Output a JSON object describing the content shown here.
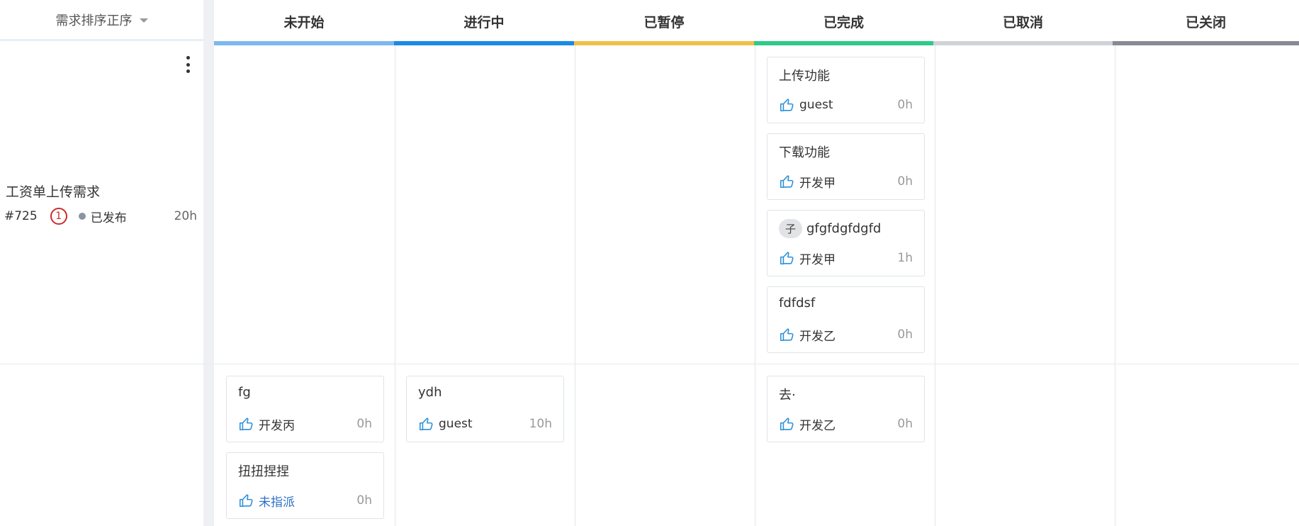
{
  "sort_label": "需求排序正序",
  "columns": [
    {
      "label": "未开始",
      "color": "#7db8ee"
    },
    {
      "label": "进行中",
      "color": "#1b8ae6"
    },
    {
      "label": "已暂停",
      "color": "#f0c04c"
    },
    {
      "label": "已完成",
      "color": "#2ecb88"
    },
    {
      "label": "已取消",
      "color": "#cfd3d8"
    },
    {
      "label": "已关闭",
      "color": "#888b94"
    }
  ],
  "story": {
    "title": "工资单上传需求",
    "id": "#725",
    "priority": "1",
    "status": "已发布",
    "hours": "20h"
  },
  "cards": {
    "upload": {
      "title": "上传功能",
      "assignee": "guest",
      "hours": "0h"
    },
    "download": {
      "title": "下载功能",
      "assignee": "开发甲",
      "hours": "0h"
    },
    "child": {
      "badge": "子",
      "title": "gfgfdgfdgfd",
      "assignee": "开发甲",
      "hours": "1h"
    },
    "fdfdsf": {
      "title": "fdfdsf",
      "assignee": "开发乙",
      "hours": "0h"
    },
    "fg": {
      "title": "fg",
      "assignee": "开发丙",
      "hours": "0h"
    },
    "niuniu": {
      "title": "扭扭捏捏",
      "assignee": "未指派",
      "hours": "0h"
    },
    "ydh": {
      "title": "ydh",
      "assignee": "guest",
      "hours": "10h"
    },
    "qu": {
      "title": "去·",
      "assignee": "开发乙",
      "hours": "0h"
    }
  },
  "icons": {
    "thumb": "thumbs-up-icon",
    "more": "more-vertical-icon",
    "sort": "caret-down-icon"
  }
}
